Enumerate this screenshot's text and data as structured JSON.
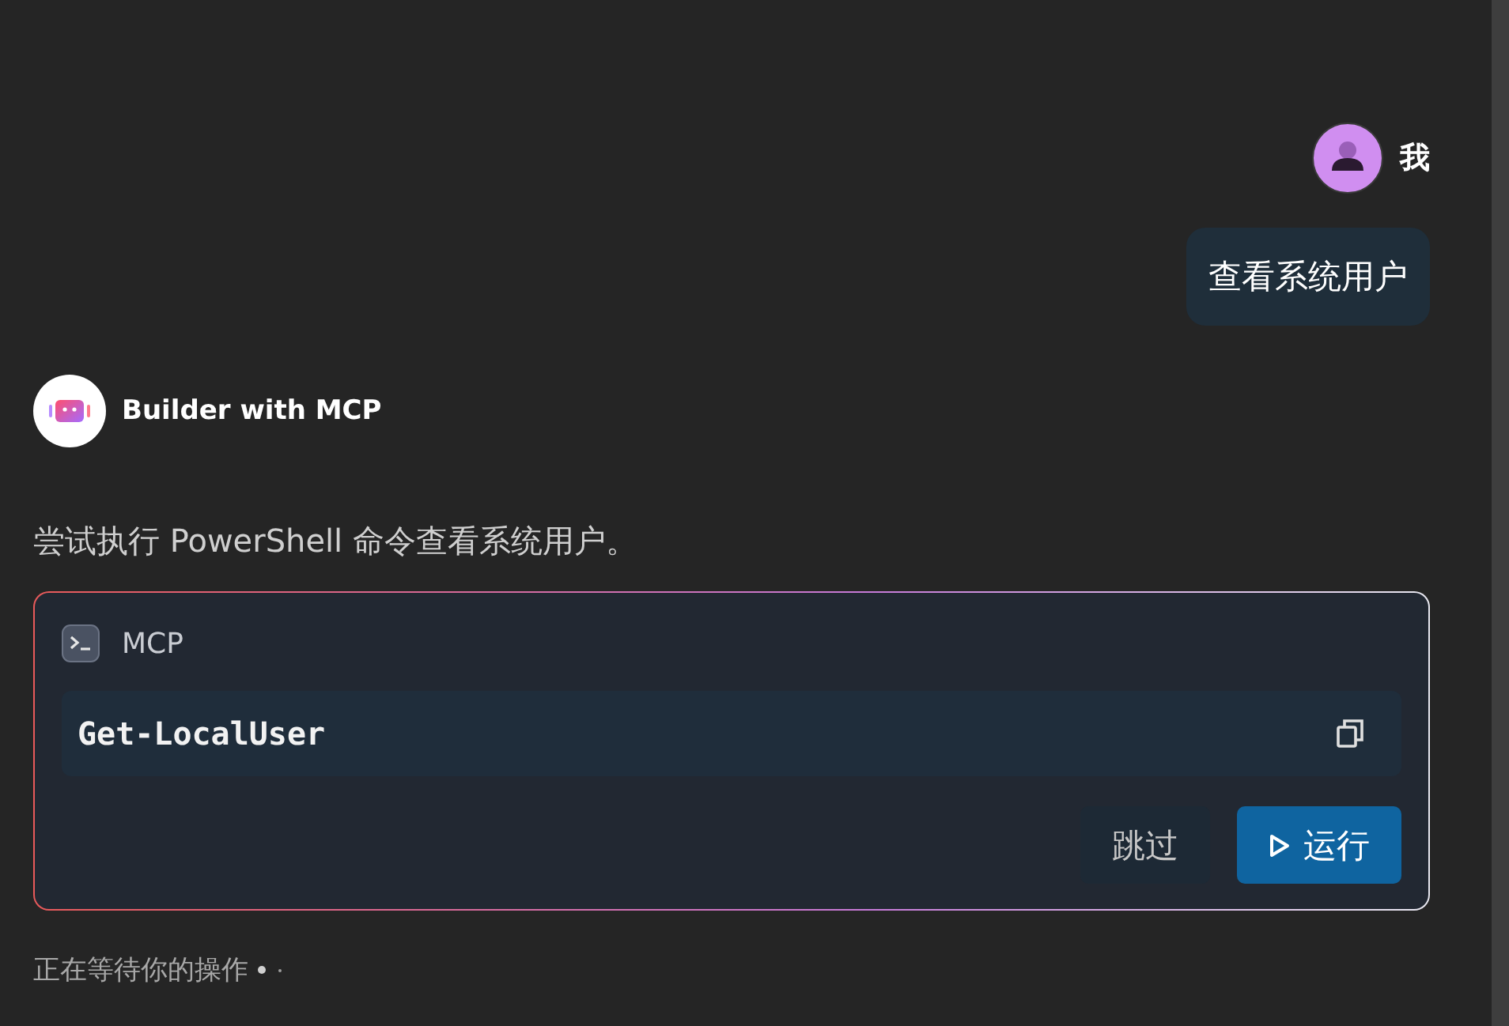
{
  "user_message": {
    "sender": "我",
    "text": "查看系统用户"
  },
  "assistant_message": {
    "sender": "Builder with MCP",
    "text": "尝试执行 PowerShell 命令查看系统用户。"
  },
  "tool_card": {
    "title": "MCP",
    "command": "Get-LocalUser",
    "buttons": [
      {
        "kind": "secondary",
        "label": "跳过"
      },
      {
        "kind": "primary",
        "label": "运行"
      }
    ]
  },
  "status": {
    "text": "正在等待你的操作"
  }
}
